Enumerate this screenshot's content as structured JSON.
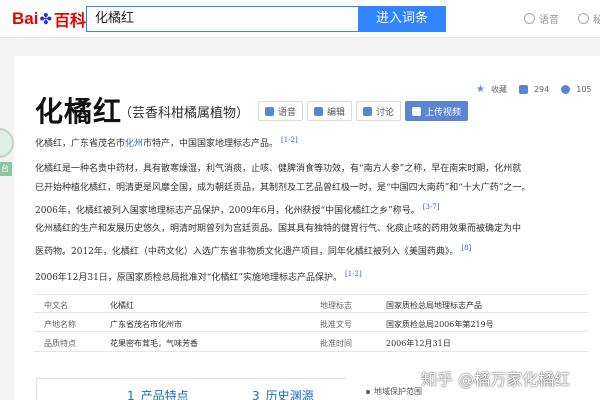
{
  "header": {
    "logo_bai": "Bai",
    "logo_paw": "✤",
    "logo_ke": "百科",
    "search_value": "化橘红",
    "search_button": "进入词条",
    "voice_label": "语音",
    "cut_label": "秘"
  },
  "side": {
    "badge": "台"
  },
  "stats": {
    "collect": "收藏",
    "likes": "294",
    "shares": "105"
  },
  "entry": {
    "title": "化橘红",
    "subtitle": "（芸香科柑橘属植物）",
    "buttons": {
      "voice": "语音",
      "edit": "编辑",
      "discuss": "讨论",
      "upload": "上传视频"
    }
  },
  "paragraphs": {
    "p1_a": "化橘红，广东省茂名市",
    "p1_link": "化州",
    "p1_b": "市特产，中国国家地理标志产品。",
    "p1_ref": "[1-2]",
    "p2_l1": "化橘红是一种名贵中药材，具有散寒燥湿，利气消痰，止咳、健脾消食等功效，有“南方人参”之称，早在南宋时期，化州就",
    "p2_l2": "已开始种植化橘红，明清更是风靡全国，成为朝廷贡品，其制剂及工艺品曾红极一时，是“中国四大南药”和“十大广药”之一。",
    "p2_l3": "2006年，化橘红被列入国家地理标志产品保护，2009年6月，化州获授“中国化橘红之乡”称号。",
    "p2_ref": "[3-7]",
    "p3_l1": "化州橘红的生产和发展历史悠久，明清时期曾列为宫廷贡品。国其具有独特的健胃行气、化痰止咳的药用效果而被确定为中",
    "p3_l2": "医药物。2012年，化橘红（中药文化）入选广东省非物质文化遗产项目，同年化橘红被列入《美国药典》。",
    "p3_ref": "[8]",
    "p4": "2006年12月31日，原国家质检总局批准对“化橘红”实施地理标志产品保护。",
    "p4_ref": "[1-2]"
  },
  "infobox": {
    "r1_l1": "中文名",
    "r1_v1": "化橘红",
    "r1_l2": "地理标志",
    "r1_v2": "国家质检总局地理标志产品",
    "r2_l1": "产地名称",
    "r2_v1": "广东省茂名市化州市",
    "r2_l2": "批准文号",
    "r2_v2": "国家质检总局2006年第219号",
    "r3_l1": "品质特点",
    "r3_v1": "花果密布茸毛，气味芳香",
    "r3_l2": "批准时间",
    "r3_v2": "2006年12月31日"
  },
  "toc": {
    "n1": "1",
    "t1": "产品特点",
    "n2": "3",
    "t2": "历史渊源",
    "side": "地域保护范围"
  },
  "watermark": "知乎 @橘万家化橘红",
  "colors": {
    "accent": "#3385ff",
    "link": "#136ec2",
    "brand_red": "#e10601"
  }
}
